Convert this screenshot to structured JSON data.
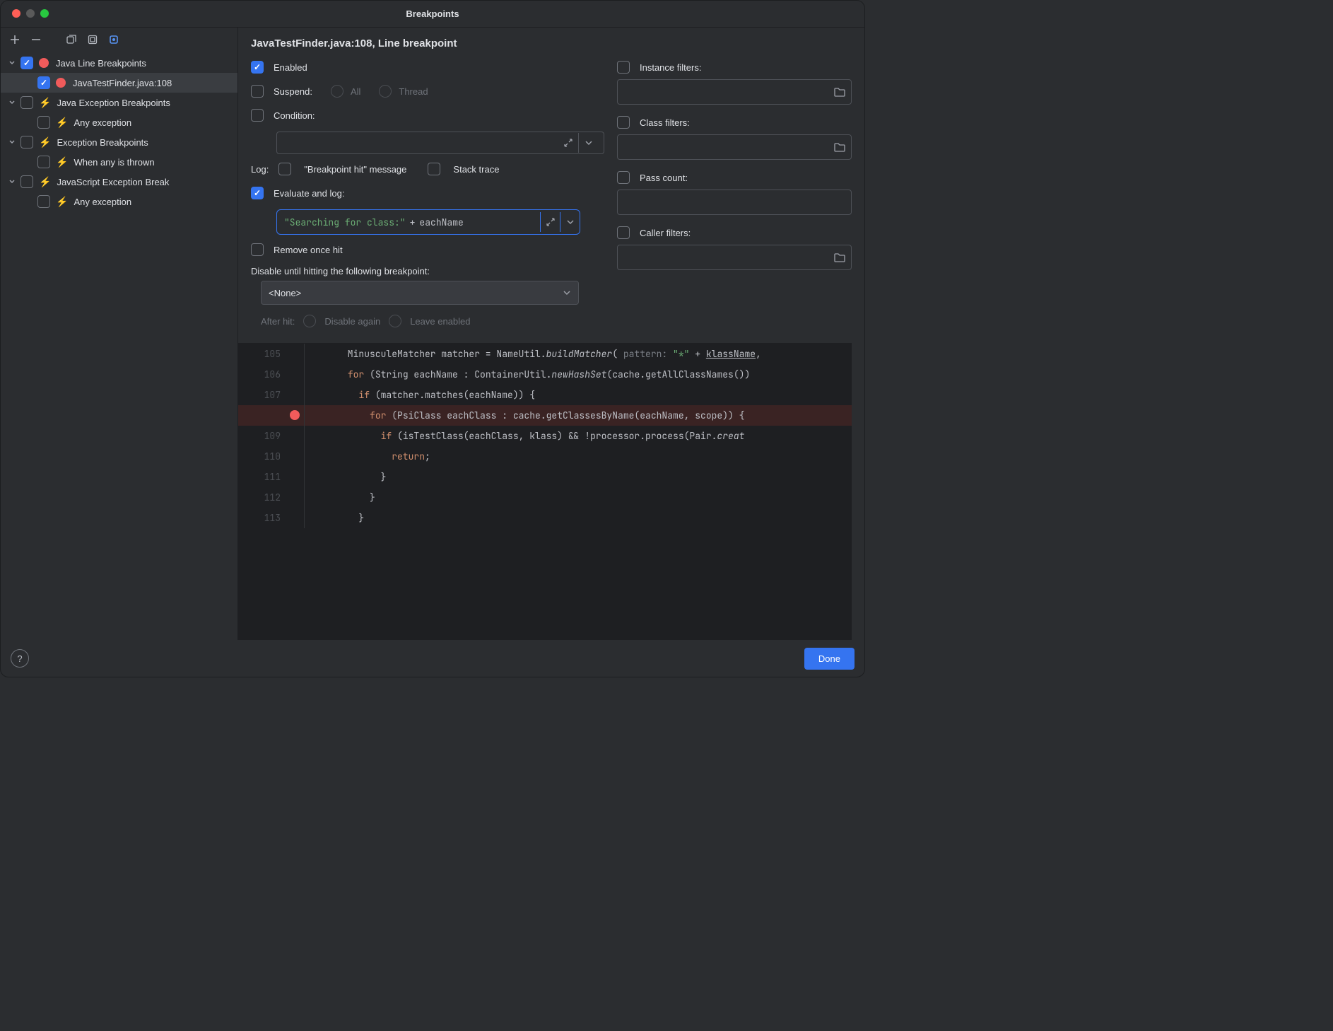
{
  "window": {
    "title": "Breakpoints"
  },
  "tree": {
    "groups": [
      {
        "label": "Java Line Breakpoints",
        "checked": true,
        "icon": "dot",
        "children": [
          {
            "label": "JavaTestFinder.java:108",
            "checked": true,
            "icon": "dot",
            "selected": true
          }
        ]
      },
      {
        "label": "Java Exception Breakpoints",
        "checked": false,
        "icon": "bolt",
        "children": [
          {
            "label": "Any exception",
            "checked": false,
            "icon": "bolt"
          }
        ]
      },
      {
        "label": "Exception Breakpoints",
        "checked": false,
        "icon": "bolt",
        "children": [
          {
            "label": "When any is thrown",
            "checked": false,
            "icon": "bolt"
          }
        ]
      },
      {
        "label": "JavaScript Exception Breakpoints",
        "checked": false,
        "icon": "bolt",
        "truncated": "JavaScript Exception Break",
        "children": [
          {
            "label": "Any exception",
            "checked": false,
            "icon": "bolt"
          }
        ]
      }
    ]
  },
  "details": {
    "heading": "JavaTestFinder.java:108, Line breakpoint",
    "enabled_label": "Enabled",
    "suspend_label": "Suspend:",
    "suspend_all": "All",
    "suspend_thread": "Thread",
    "condition_label": "Condition:",
    "log_label": "Log:",
    "log_bp_hit": "\"Breakpoint hit\" message",
    "log_stack": "Stack trace",
    "eval_label": "Evaluate and log:",
    "eval_string": "\"Searching for class:\"",
    "eval_op": "+",
    "eval_id": "eachName",
    "remove_label": "Remove once hit",
    "disable_until_label": "Disable until hitting the following breakpoint:",
    "disable_until_value": "<None>",
    "after_hit_label": "After hit:",
    "after_hit_disable": "Disable again",
    "after_hit_leave": "Leave enabled",
    "instance_filters": "Instance filters:",
    "class_filters": "Class filters:",
    "pass_count": "Pass count:",
    "caller_filters": "Caller filters:"
  },
  "code": {
    "lines": [
      {
        "n": "105",
        "html": "      MinusculeMatcher matcher = NameUtil.<span class='mth'>buildMatcher</span>( <span class='prm'>pattern:</span> <span class='str'>\"*\"</span> + <span class='und'>klassName</span>,"
      },
      {
        "n": "106",
        "html": "      <span class='kw'>for</span> (String eachName : ContainerUtil.<span class='mth'>newHashSet</span>(cache.getAllClassNames())"
      },
      {
        "n": "107",
        "html": "        <span class='kw'>if</span> (matcher.matches(eachName)) {"
      },
      {
        "n": "",
        "html": "          <span class='kw'>for</span> (PsiClass eachClass : cache.getClassesByName(eachName, scope)) {",
        "bp": true,
        "hl": true
      },
      {
        "n": "109",
        "html": "            <span class='kw'>if</span> (isTestClass(eachClass, klass) && !processor.process(Pair.<span class='mth'>creat</span>"
      },
      {
        "n": "110",
        "html": "              <span class='kw'>return</span>;"
      },
      {
        "n": "111",
        "html": "            }"
      },
      {
        "n": "112",
        "html": "          }"
      },
      {
        "n": "113",
        "html": "        }"
      }
    ]
  },
  "footer": {
    "done": "Done"
  }
}
